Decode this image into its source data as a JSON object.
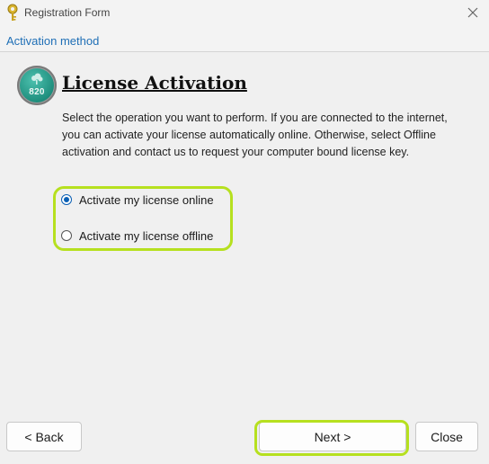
{
  "window": {
    "title": "Registration Form",
    "icon": "key-icon",
    "close_icon": "close-icon"
  },
  "breadcrumb": {
    "label": "Activation method"
  },
  "badge": {
    "text": "820",
    "icon": "cloud-badge-icon",
    "color": "#1f8f7e"
  },
  "content": {
    "heading": "License Activation",
    "description": "Select the operation you want to perform. If you are connected to the internet, you can activate your license automatically online. Otherwise, select Offline activation and contact us to request your computer bound license key."
  },
  "options": {
    "online": {
      "label": "Activate my license online",
      "selected": true
    },
    "offline": {
      "label": "Activate my license offline",
      "selected": false
    }
  },
  "buttons": {
    "back": "< Back",
    "next": "Next >",
    "close": "Close"
  },
  "highlight_color": "#b6e01f",
  "accent_color": "#0a5fb4"
}
